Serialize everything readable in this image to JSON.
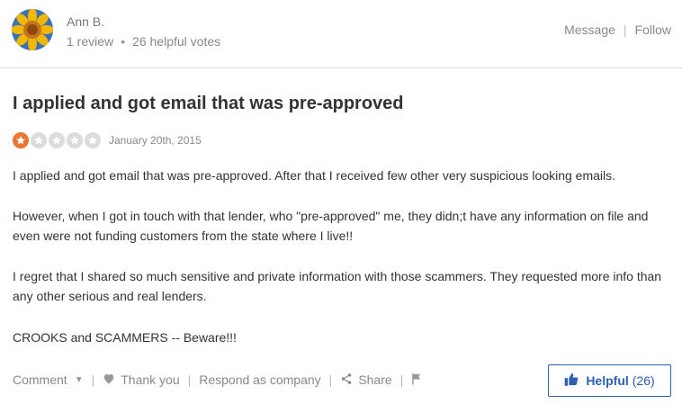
{
  "reviewer": {
    "name": "Ann B.",
    "reviews": "1 review",
    "helpful_votes": "26 helpful votes",
    "avatar": "sunflower-avatar"
  },
  "header_actions": {
    "message": "Message",
    "separator": "|",
    "follow": "Follow"
  },
  "review": {
    "title": "I applied and got email that was pre-approved",
    "rating": 1,
    "rating_max": 5,
    "date": "January 20th, 2015",
    "paragraphs": [
      "I applied and got email that was pre-approved. After that I received few other very suspicious looking emails.",
      "However, when I got in touch with that lender, who \"pre-approved\" me, they didn;t have any information on file and even were not funding customers from the state where I live!!",
      "I regret that I shared so much sensitive and private information with those scammers. They requested more info than any other serious and real lenders.",
      "CROOKS and SCAMMERS -- Beware!!!"
    ]
  },
  "actions": {
    "separator": "|",
    "comment": "Comment",
    "thank_you": "Thank you",
    "respond": "Respond as company",
    "share": "Share",
    "helpful_label": "Helpful",
    "helpful_count": "(26)"
  },
  "colors": {
    "accent_blue": "#2d5fb5",
    "star_orange": "#e8762d",
    "star_empty": "#dcdcdc",
    "muted_text": "#888888"
  },
  "icons": [
    "chevron-down-icon",
    "heart-icon",
    "share-icon",
    "flag-icon",
    "thumbs-up-icon",
    "star-icon"
  ]
}
